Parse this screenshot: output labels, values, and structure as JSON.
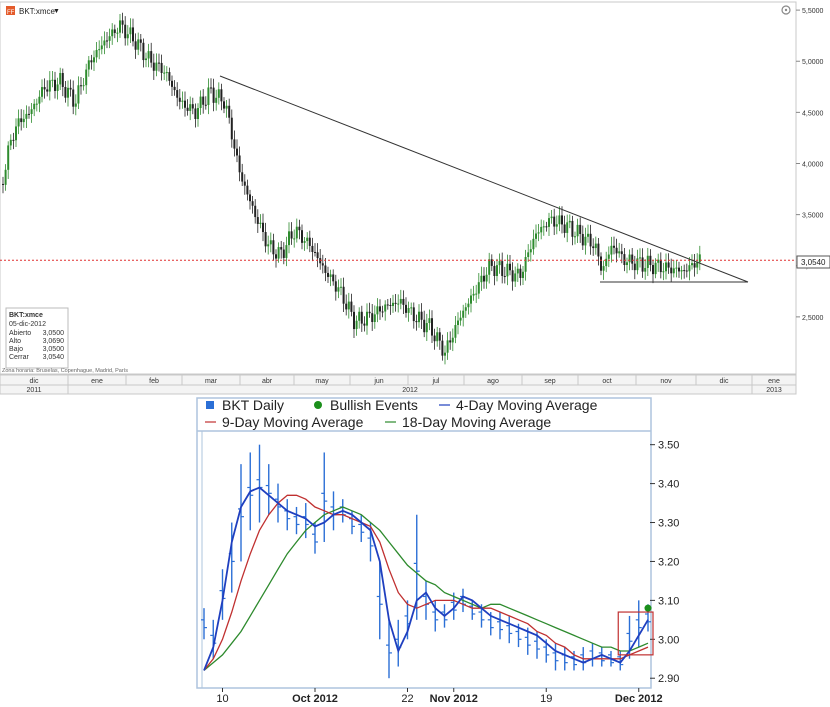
{
  "top_chart": {
    "symbol": "BKT:xmce",
    "price_badge": "3,0540",
    "y_ticks": [
      "5,5000",
      "5,0000",
      "4,5000",
      "4,0000",
      "3,5000",
      "3,0000",
      "2,5000"
    ],
    "y_values": [
      5.5,
      5.0,
      4.5,
      4.0,
      3.5,
      3.0,
      2.5
    ],
    "months": [
      "dic",
      "ene",
      "feb",
      "mar",
      "abr",
      "may",
      "jun",
      "jul",
      "ago",
      "sep",
      "oct",
      "nov",
      "dic",
      "ene"
    ],
    "years": [
      "2011",
      "2012",
      "2013"
    ],
    "timezone": "Zona horaria: Bruselas, Copenhague, Madrid, París",
    "info": {
      "title": "BKT:xmce",
      "date": "05-dic-2012",
      "rows": [
        {
          "label": "Abierto",
          "value": "3,0500"
        },
        {
          "label": "Alto",
          "value": "3,0690"
        },
        {
          "label": "Bajo",
          "value": "3,0500"
        },
        {
          "label": "Cerrar",
          "value": "3,0540"
        }
      ]
    },
    "colors": {
      "up": "#2e8b2e",
      "down": "#222222",
      "reference": "#e03030"
    }
  },
  "chart_data": [
    {
      "type": "line",
      "title": "BKT:xmce",
      "xlabel": "",
      "ylabel": "",
      "ylim": [
        2.0,
        5.5
      ],
      "x": [
        "dic-2011",
        "ene-2012",
        "feb-2012",
        "mar-2012",
        "abr-2012",
        "may-2012",
        "jun-2012",
        "jul-2012",
        "ago-2012",
        "sep-2012",
        "oct-2012",
        "nov-2012",
        "dic-2012"
      ],
      "series": [
        {
          "values": [
            3.9,
            4.4,
            5.3,
            4.7,
            3.2,
            3.0,
            2.5,
            2.2,
            3.0,
            3.35,
            3.1,
            2.95,
            3.05
          ]
        }
      ],
      "reference_line": 3.054,
      "trendlines": [
        {
          "from": [
            "mar-2012",
            4.8
          ],
          "to": [
            "dic-2012",
            2.85
          ]
        },
        {
          "from": [
            "oct-2012",
            2.85
          ],
          "to": [
            "dic-2012",
            2.85
          ]
        }
      ]
    },
    {
      "type": "line",
      "title": "",
      "ylim": [
        2.88,
        3.53
      ],
      "y_ticks": [
        "3.50",
        "3.40",
        "3.30",
        "3.20",
        "3.10",
        "3.00",
        "2.90"
      ],
      "x_labels": [
        "10",
        "Oct 2012",
        "22",
        "Nov 2012",
        "19",
        "Dec 2012"
      ],
      "legend": [
        "BKT Daily",
        "Bullish Events",
        "4-Day Moving Average",
        "9-Day Moving Average",
        "18-Day Moving Average"
      ],
      "series": [
        {
          "name": "4-Day Moving Average",
          "color": "#1f3fbf",
          "values": [
            2.92,
            2.98,
            3.1,
            3.25,
            3.34,
            3.38,
            3.39,
            3.37,
            3.35,
            3.33,
            3.32,
            3.31,
            3.29,
            3.3,
            3.32,
            3.33,
            3.32,
            3.3,
            3.28,
            3.2,
            3.05,
            2.97,
            3.02,
            3.1,
            3.12,
            3.08,
            3.06,
            3.08,
            3.11,
            3.1,
            3.08,
            3.06,
            3.05,
            3.04,
            3.03,
            3.02,
            3.01,
            2.99,
            2.97,
            2.96,
            2.95,
            2.94,
            2.95,
            2.96,
            2.95,
            2.94,
            2.97,
            3.01,
            3.05
          ]
        },
        {
          "name": "9-Day Moving Average",
          "color": "#c03030",
          "values": [
            2.92,
            2.95,
            3.0,
            3.07,
            3.15,
            3.22,
            3.28,
            3.32,
            3.35,
            3.37,
            3.37,
            3.36,
            3.34,
            3.33,
            3.32,
            3.32,
            3.31,
            3.3,
            3.29,
            3.25,
            3.18,
            3.12,
            3.09,
            3.08,
            3.09,
            3.1,
            3.1,
            3.1,
            3.09,
            3.08,
            3.08,
            3.08,
            3.07,
            3.06,
            3.05,
            3.04,
            3.02,
            3.01,
            2.99,
            2.98,
            2.96,
            2.95,
            2.95,
            2.95,
            2.95,
            2.95,
            2.96,
            2.97,
            2.98
          ]
        },
        {
          "name": "18-Day Moving Average",
          "color": "#2d8a2d",
          "values": [
            2.92,
            2.94,
            2.96,
            2.99,
            3.02,
            3.06,
            3.1,
            3.14,
            3.18,
            3.22,
            3.25,
            3.28,
            3.3,
            3.32,
            3.33,
            3.34,
            3.33,
            3.32,
            3.3,
            3.28,
            3.25,
            3.22,
            3.19,
            3.17,
            3.15,
            3.14,
            3.12,
            3.11,
            3.1,
            3.09,
            3.08,
            3.09,
            3.09,
            3.08,
            3.07,
            3.06,
            3.05,
            3.04,
            3.03,
            3.02,
            3.01,
            3.0,
            2.99,
            2.98,
            2.98,
            2.97,
            2.97,
            2.98,
            2.99
          ]
        }
      ],
      "bars": [
        [
          3.0,
          3.08
        ],
        [
          2.95,
          3.05
        ],
        [
          3.05,
          3.18
        ],
        [
          3.12,
          3.3
        ],
        [
          3.2,
          3.45
        ],
        [
          3.28,
          3.48
        ],
        [
          3.3,
          3.5
        ],
        [
          3.32,
          3.45
        ],
        [
          3.3,
          3.4
        ],
        [
          3.28,
          3.36
        ],
        [
          3.27,
          3.34
        ],
        [
          3.26,
          3.35
        ],
        [
          3.22,
          3.3
        ],
        [
          3.25,
          3.48
        ],
        [
          3.28,
          3.38
        ],
        [
          3.3,
          3.36
        ],
        [
          3.27,
          3.33
        ],
        [
          3.25,
          3.32
        ],
        [
          3.2,
          3.3
        ],
        [
          3.0,
          3.2
        ],
        [
          2.9,
          3.05
        ],
        [
          2.93,
          3.05
        ],
        [
          3.0,
          3.1
        ],
        [
          3.05,
          3.32
        ],
        [
          3.05,
          3.15
        ],
        [
          3.02,
          3.1
        ],
        [
          3.03,
          3.09
        ],
        [
          3.05,
          3.12
        ],
        [
          3.07,
          3.13
        ],
        [
          3.05,
          3.1
        ],
        [
          3.03,
          3.09
        ],
        [
          3.01,
          3.07
        ],
        [
          3.0,
          3.07
        ],
        [
          2.99,
          3.06
        ],
        [
          2.98,
          3.04
        ],
        [
          2.96,
          3.03
        ],
        [
          2.95,
          3.02
        ],
        [
          2.94,
          3.0
        ],
        [
          2.92,
          2.99
        ],
        [
          2.92,
          2.98
        ],
        [
          2.92,
          2.97
        ],
        [
          2.92,
          2.98
        ],
        [
          2.93,
          2.99
        ],
        [
          2.93,
          2.98
        ],
        [
          2.93,
          2.97
        ],
        [
          2.92,
          2.97
        ],
        [
          2.95,
          3.06
        ],
        [
          2.98,
          3.1
        ],
        [
          3.02,
          3.09
        ]
      ],
      "bullish_event": {
        "index": 48,
        "value": 3.08
      },
      "highlight_range": {
        "from_index": 45,
        "to_index": 48,
        "low": 2.96,
        "high": 3.07
      }
    }
  ],
  "bottom_chart": {
    "legend": [
      {
        "label": "BKT Daily",
        "type": "square",
        "color": "#2b6fd6"
      },
      {
        "label": "Bullish Events",
        "type": "dot",
        "color": "#1b8f1b"
      },
      {
        "label": "4-Day Moving Average",
        "type": "line",
        "color": "#1f3fbf"
      },
      {
        "label": "9-Day Moving Average",
        "type": "line",
        "color": "#c03030"
      },
      {
        "label": "18-Day Moving Average",
        "type": "line",
        "color": "#2d8a2d"
      }
    ],
    "bar_color": "#2b6fd6",
    "frame_color": "#aec4dd"
  }
}
